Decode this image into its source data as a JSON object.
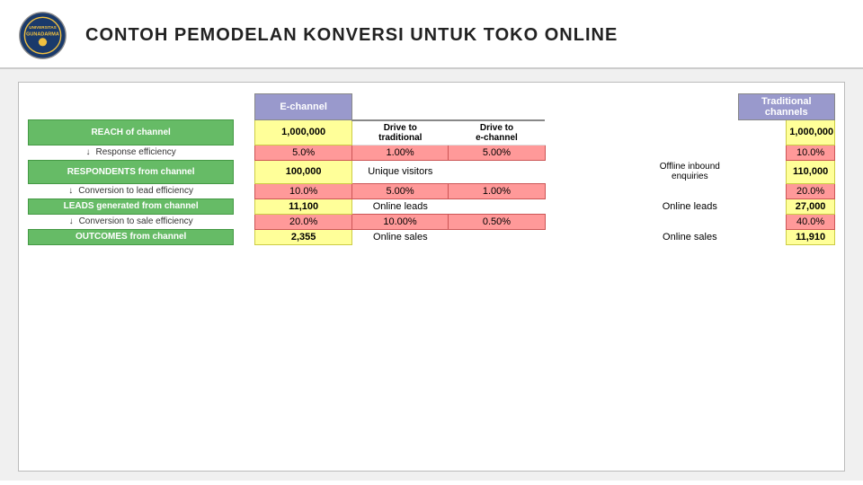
{
  "header": {
    "title": "CONTOH PEMODELAN KONVERSI UNTUK TOKO ONLINE"
  },
  "channels": {
    "echannel_label": "E-channel",
    "traditional_label": "Traditional channels"
  },
  "rows": {
    "reach_label": "REACH of channel",
    "reach_echannel_val": "1,000,000",
    "reach_traditional_val": "1,000,000",
    "drive_to_traditional": "Drive to\ntraditional",
    "drive_to_echannel": "Drive to\ne-channel",
    "response_label": "Response efficiency",
    "response_e_pct": "5.0%",
    "response_drive_trad_pct": "1.00%",
    "response_drive_echan_pct": "5.00%",
    "response_trad_pct": "10.0%",
    "respondents_label": "RESPONDENTS from channel",
    "respondents_e_val": "100,000",
    "respondents_e_text": "Unique visitors",
    "respondents_trad_text": "Offline inbound enquiries",
    "respondents_trad_val": "110,000",
    "conv_lead_label": "Conversion to lead efficiency",
    "conv_lead_e_pct": "10.0%",
    "conv_lead_drive_trad_pct": "5.00%",
    "conv_lead_drive_echan_pct": "1.00%",
    "conv_lead_trad_pct": "20.0%",
    "leads_label": "LEADS generated from channel",
    "leads_e_val": "11,100",
    "leads_e_text": "Online leads",
    "leads_trad_text": "Online leads",
    "leads_trad_val": "27,000",
    "conv_sale_label": "Conversion to sale efficiency",
    "conv_sale_e_pct": "20.0%",
    "conv_sale_drive_trad_pct": "10.00%",
    "conv_sale_drive_echan_pct": "0.50%",
    "conv_sale_trad_pct": "40.0%",
    "outcomes_label": "OUTCOMES from channel",
    "outcomes_e_val": "2,355",
    "outcomes_e_text": "Online sales",
    "outcomes_trad_text": "Online sales",
    "outcomes_trad_val": "11,910"
  }
}
